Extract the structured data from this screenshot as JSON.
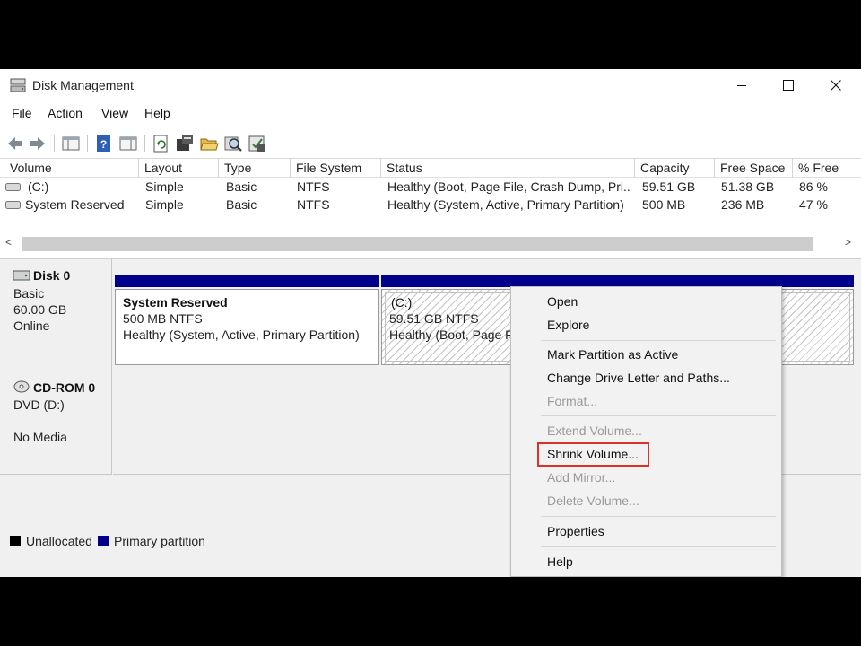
{
  "window": {
    "title": "Disk Management",
    "icon": "disk-management-icon"
  },
  "menubar": {
    "items": [
      "File",
      "Action",
      "View",
      "Help"
    ]
  },
  "toolbar": {
    "icons": [
      "back-arrow-icon",
      "forward-arrow-icon",
      "show-hide-console-tree-icon",
      "help-icon",
      "action-pane-icon",
      "refresh-icon",
      "properties-icon",
      "open-folder-icon",
      "find-icon",
      "disk-settings-icon"
    ]
  },
  "volume_list": {
    "columns": [
      "Volume",
      "Layout",
      "Type",
      "File System",
      "Status",
      "Capacity",
      "Free Space",
      "% Free"
    ],
    "rows": [
      {
        "volume": "(C:)",
        "layout": "Simple",
        "type": "Basic",
        "fs": "NTFS",
        "status": "Healthy (Boot, Page File, Crash Dump, Pri...",
        "capacity": "59.51 GB",
        "free": "51.38 GB",
        "pct": "86 %"
      },
      {
        "volume": "System Reserved",
        "layout": "Simple",
        "type": "Basic",
        "fs": "NTFS",
        "status": "Healthy (System, Active, Primary Partition)",
        "capacity": "500 MB",
        "free": "236 MB",
        "pct": "47 %"
      }
    ],
    "scroll_left": "<",
    "scroll_right": ">"
  },
  "disks": [
    {
      "name": "Disk 0",
      "lines": [
        "Basic",
        "60.00 GB",
        "Online"
      ],
      "partitions": [
        {
          "title": "System Reserved",
          "lines": [
            "500 MB NTFS",
            "Healthy (System, Active, Primary Partition)"
          ]
        },
        {
          "title": "(C:)",
          "lines": [
            "59.51 GB NTFS",
            "Healthy (Boot, Page F"
          ]
        }
      ]
    },
    {
      "name": "CD-ROM 0",
      "lines": [
        "DVD (D:)",
        "",
        "No Media"
      ]
    }
  ],
  "legend": [
    {
      "label": "Unallocated",
      "color": "#000000"
    },
    {
      "label": "Primary partition",
      "color": "#00008b"
    }
  ],
  "context_menu": {
    "groups": [
      [
        {
          "label": "Open",
          "enabled": true
        },
        {
          "label": "Explore",
          "enabled": true
        }
      ],
      [
        {
          "label": "Mark Partition as Active",
          "enabled": true
        },
        {
          "label": "Change Drive Letter and Paths...",
          "enabled": true
        },
        {
          "label": "Format...",
          "enabled": false
        }
      ],
      [
        {
          "label": "Extend Volume...",
          "enabled": false
        },
        {
          "label": "Shrink Volume...",
          "enabled": true,
          "highlighted": true
        },
        {
          "label": "Add Mirror...",
          "enabled": false
        },
        {
          "label": "Delete Volume...",
          "enabled": false
        }
      ],
      [
        {
          "label": "Properties",
          "enabled": true
        }
      ],
      [
        {
          "label": "Help",
          "enabled": true
        }
      ]
    ],
    "highlight_color": "#d9342b"
  }
}
